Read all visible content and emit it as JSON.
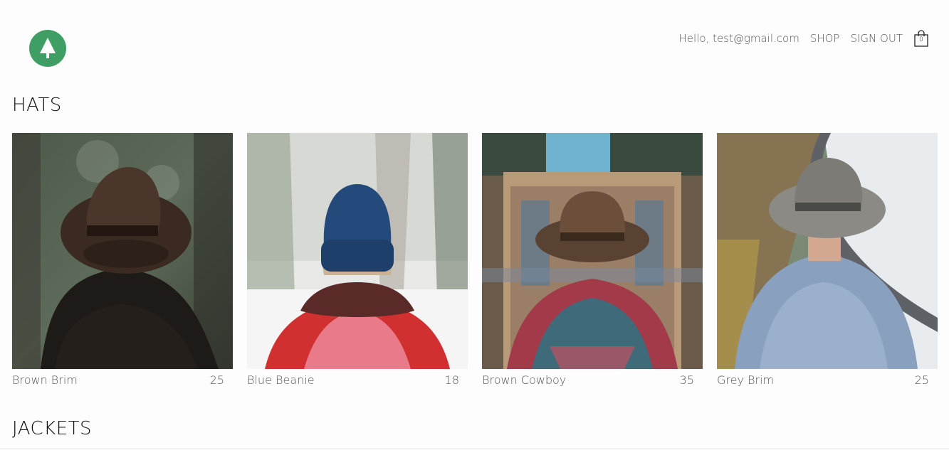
{
  "header": {
    "greeting": "Hello, test@gmail.com",
    "shop_label": "SHOP",
    "signout_label": "SIGN OUT",
    "cart_count": "0",
    "logo_icon": "pine-tree-icon",
    "accent_color": "#3f9e64"
  },
  "sections": [
    {
      "title": "HATS",
      "items": [
        {
          "name": "Brown Brim",
          "price": "25"
        },
        {
          "name": "Blue Beanie",
          "price": "18"
        },
        {
          "name": "Brown Cowboy",
          "price": "35"
        },
        {
          "name": "Grey Brim",
          "price": "25"
        }
      ]
    },
    {
      "title": "JACKETS",
      "items": []
    }
  ]
}
